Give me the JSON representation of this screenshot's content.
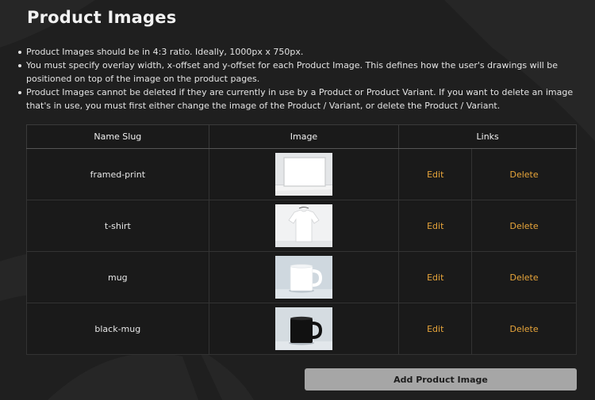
{
  "page": {
    "title": "Product Images",
    "notes": [
      "Product Images should be in 4:3 ratio. Ideally, 1000px x 750px.",
      "You must specify overlay width, x-offset and y-offset for each Product Image. This defines how the user's drawings will be positioned on top of the image on the product pages.",
      "Product Images cannot be deleted if they are currently in use by a Product or Product Variant. If you want to delete an image that's in use, you must first either change the image of the Product / Variant, or delete the Product / Variant."
    ]
  },
  "table": {
    "headers": {
      "slug": "Name Slug",
      "image": "Image",
      "links": "Links"
    },
    "rows": [
      {
        "slug": "framed-print",
        "image_icon": "framed-print-thumbnail",
        "edit": "Edit",
        "delete": "Delete"
      },
      {
        "slug": "t-shirt",
        "image_icon": "t-shirt-thumbnail",
        "edit": "Edit",
        "delete": "Delete"
      },
      {
        "slug": "mug",
        "image_icon": "white-mug-thumbnail",
        "edit": "Edit",
        "delete": "Delete"
      },
      {
        "slug": "black-mug",
        "image_icon": "black-mug-thumbnail",
        "edit": "Edit",
        "delete": "Delete"
      }
    ]
  },
  "actions": {
    "add_label": "Add Product Image"
  },
  "colors": {
    "background": "#1f1f1f",
    "link": "#e8a53a",
    "button": "#a6a6a6"
  }
}
